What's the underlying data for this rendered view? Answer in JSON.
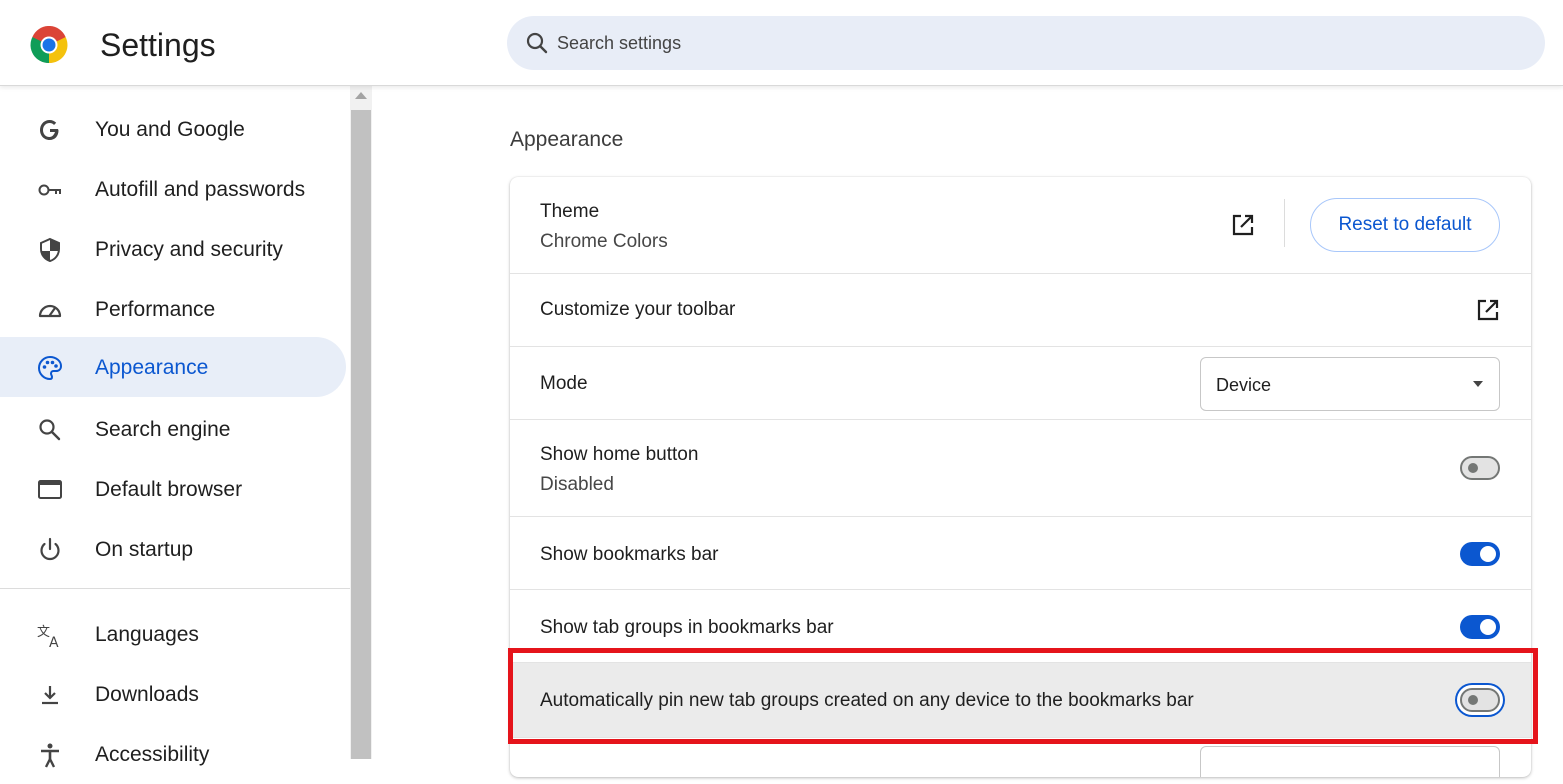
{
  "header": {
    "title": "Settings",
    "search_placeholder": "Search settings"
  },
  "sidebar": {
    "items": [
      {
        "label": "You and Google",
        "icon": "google-g-icon"
      },
      {
        "label": "Autofill and passwords",
        "icon": "key-icon"
      },
      {
        "label": "Privacy and security",
        "icon": "shield-icon"
      },
      {
        "label": "Performance",
        "icon": "speedometer-icon"
      },
      {
        "label": "Appearance",
        "icon": "palette-icon",
        "active": true
      },
      {
        "label": "Search engine",
        "icon": "search-icon"
      },
      {
        "label": "Default browser",
        "icon": "browser-window-icon"
      },
      {
        "label": "On startup",
        "icon": "power-icon"
      },
      {
        "label": "Languages",
        "icon": "translate-icon"
      },
      {
        "label": "Downloads",
        "icon": "download-icon"
      },
      {
        "label": "Accessibility",
        "icon": "accessibility-icon"
      }
    ]
  },
  "main": {
    "section_title": "Appearance",
    "theme": {
      "label": "Theme",
      "value": "Chrome Colors",
      "reset_label": "Reset to default"
    },
    "toolbar": {
      "label": "Customize your toolbar"
    },
    "mode": {
      "label": "Mode",
      "value": "Device"
    },
    "home_button": {
      "label": "Show home button",
      "sub": "Disabled",
      "enabled": false
    },
    "bookmarks_bar": {
      "label": "Show bookmarks bar",
      "enabled": true
    },
    "tab_groups": {
      "label": "Show tab groups in bookmarks bar",
      "enabled": true
    },
    "auto_pin": {
      "label": "Automatically pin new tab groups created on any device to the bookmarks bar",
      "enabled": false
    }
  },
  "colors": {
    "accent": "#0b57d0",
    "highlight_outline": "#e5141b",
    "active_nav_bg": "#e8eef8"
  }
}
